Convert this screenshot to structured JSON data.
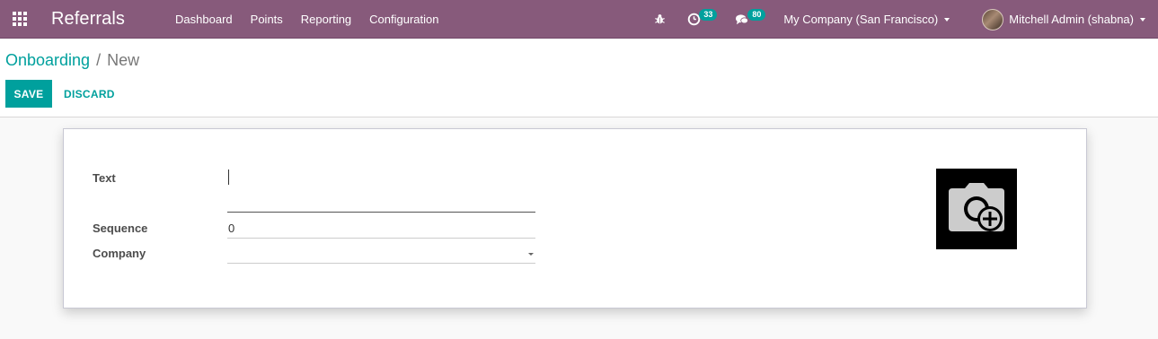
{
  "navbar": {
    "app_title": "Referrals",
    "menu": [
      {
        "label": "Dashboard"
      },
      {
        "label": "Points"
      },
      {
        "label": "Reporting"
      },
      {
        "label": "Configuration"
      }
    ],
    "activity_count": "33",
    "messages_count": "80",
    "company": "My Company (San Francisco)",
    "user": "Mitchell Admin (shabna)"
  },
  "breadcrumb": {
    "parent": "Onboarding",
    "separator": "/",
    "current": "New"
  },
  "buttons": {
    "save": "SAVE",
    "discard": "DISCARD"
  },
  "form": {
    "text_label": "Text",
    "text_value": "",
    "sequence_label": "Sequence",
    "sequence_value": "0",
    "company_label": "Company",
    "company_value": ""
  },
  "colors": {
    "navbar": "#875a7b",
    "accent": "#00a09d"
  }
}
